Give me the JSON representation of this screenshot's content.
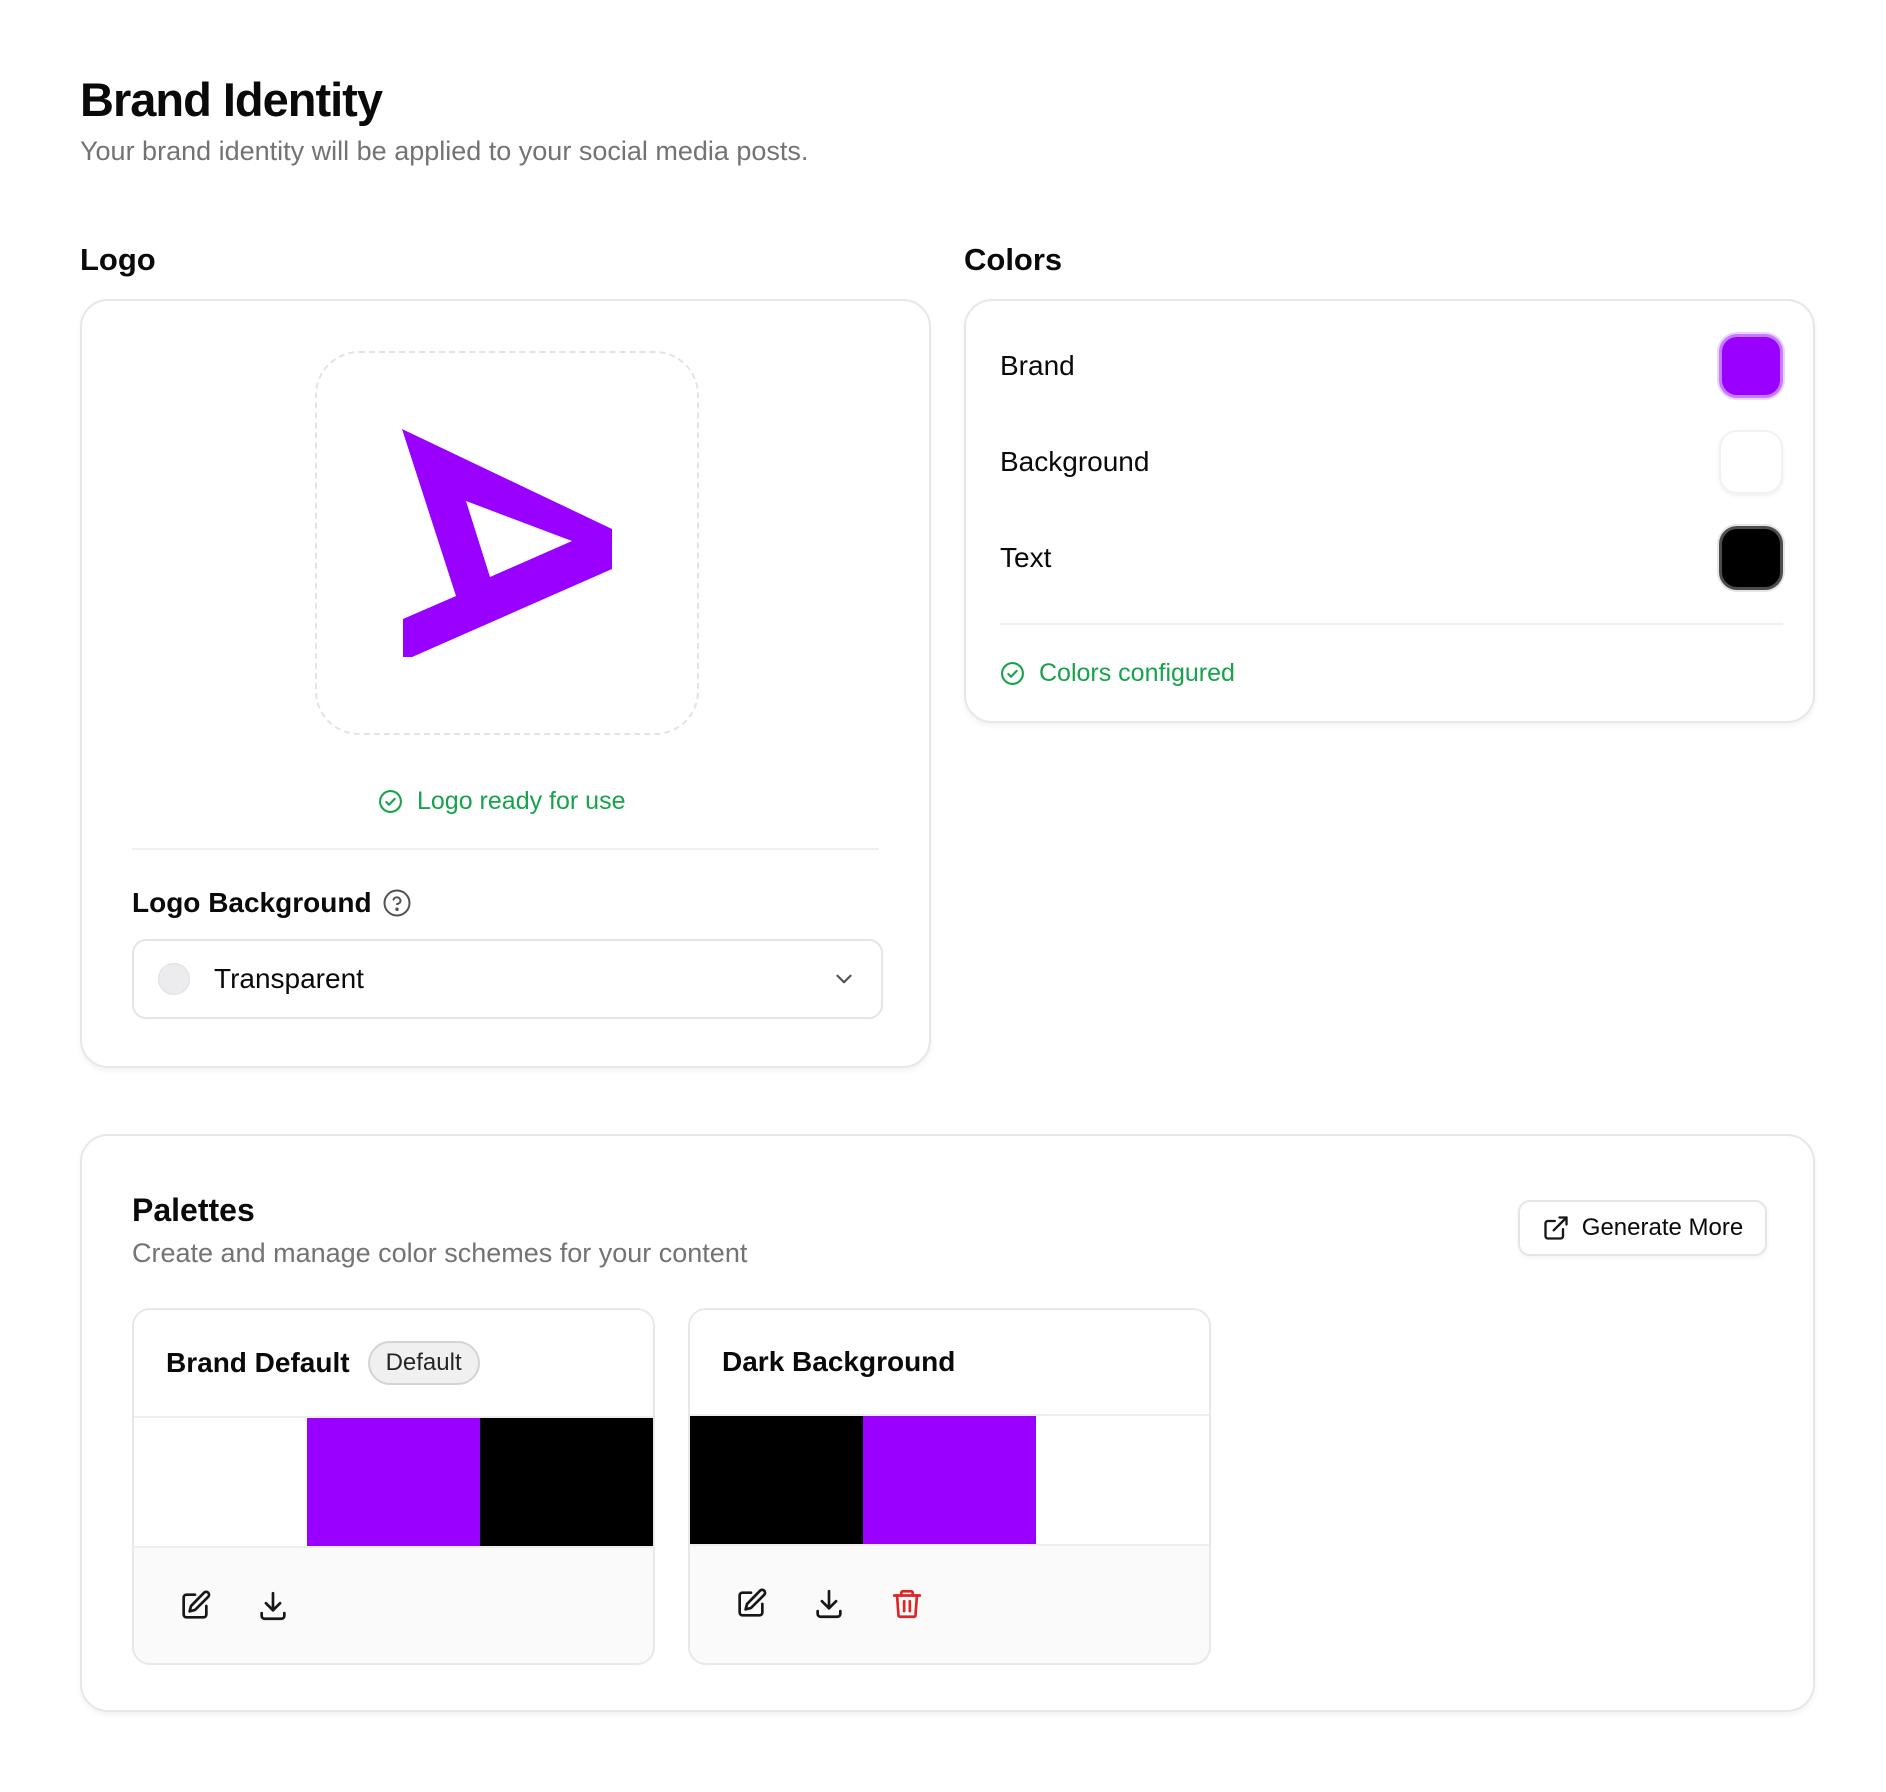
{
  "header": {
    "title": "Brand Identity",
    "subtitle": "Your brand identity will be applied to your social media posts."
  },
  "logo": {
    "section_label": "Logo",
    "logo_color": "#9900ff",
    "status": "Logo ready for use",
    "background_label": "Logo Background",
    "background_value": "Transparent"
  },
  "colors": {
    "section_label": "Colors",
    "items": [
      {
        "name": "Brand",
        "hex": "#9900ff"
      },
      {
        "name": "Background",
        "hex": "#ffffff"
      },
      {
        "name": "Text",
        "hex": "#000000"
      }
    ],
    "status": "Colors configured"
  },
  "palettes": {
    "title": "Palettes",
    "subtitle": "Create and manage color schemes for your content",
    "generate_label": "Generate More",
    "items": [
      {
        "name": "Brand Default",
        "badge": "Default",
        "colors": [
          "#ffffff",
          "#9900ff",
          "#000000"
        ]
      },
      {
        "name": "Dark Background",
        "colors": [
          "#000000",
          "#9900ff",
          "#ffffff"
        ]
      }
    ]
  },
  "theme": {
    "success": "#16a34a",
    "danger": "#dc2626",
    "muted": "#737373"
  }
}
